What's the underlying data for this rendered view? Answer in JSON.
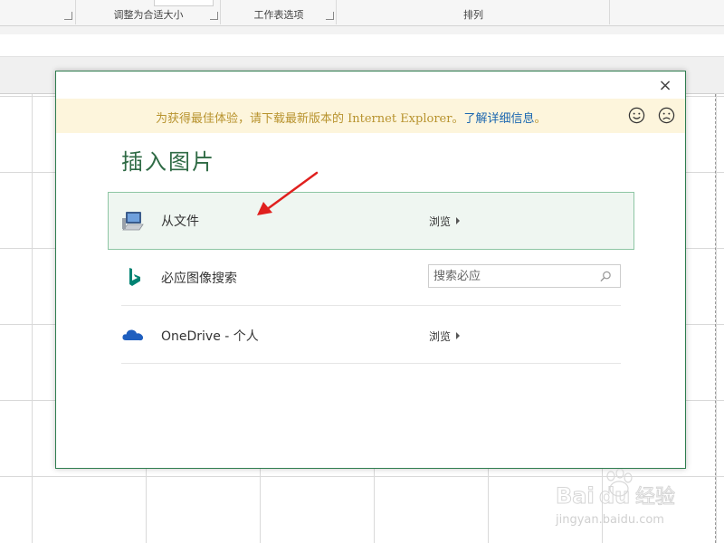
{
  "ribbon": {
    "groups": [
      {
        "label": ""
      },
      {
        "label": "调整为合适大小"
      },
      {
        "label": "工作表选项"
      },
      {
        "label": "排列"
      }
    ]
  },
  "dialog": {
    "title": "插入图片",
    "close_glyph": "×",
    "notice": {
      "text": "为获得最佳体验，请下载最新版本的 Internet Explorer。",
      "link": "了解详细信息",
      "suffix": "。"
    },
    "sources": [
      {
        "label": "从文件",
        "action": "浏览",
        "icon": "computer-icon",
        "highlighted": true
      },
      {
        "label": "必应图像搜索",
        "search_placeholder": "搜索必应",
        "icon": "bing-icon"
      },
      {
        "label": "OneDrive - 个人",
        "action": "浏览",
        "icon": "cloud-icon"
      }
    ]
  },
  "watermark": {
    "brand": "Baidu经验",
    "url": "jingyan.baidu.com"
  },
  "colors": {
    "accent_green": "#2f7d4f",
    "notice_bg": "#fdf5dc",
    "notice_text": "#b8932e",
    "link": "#1b67b0",
    "arrow_red": "#e0201e"
  }
}
